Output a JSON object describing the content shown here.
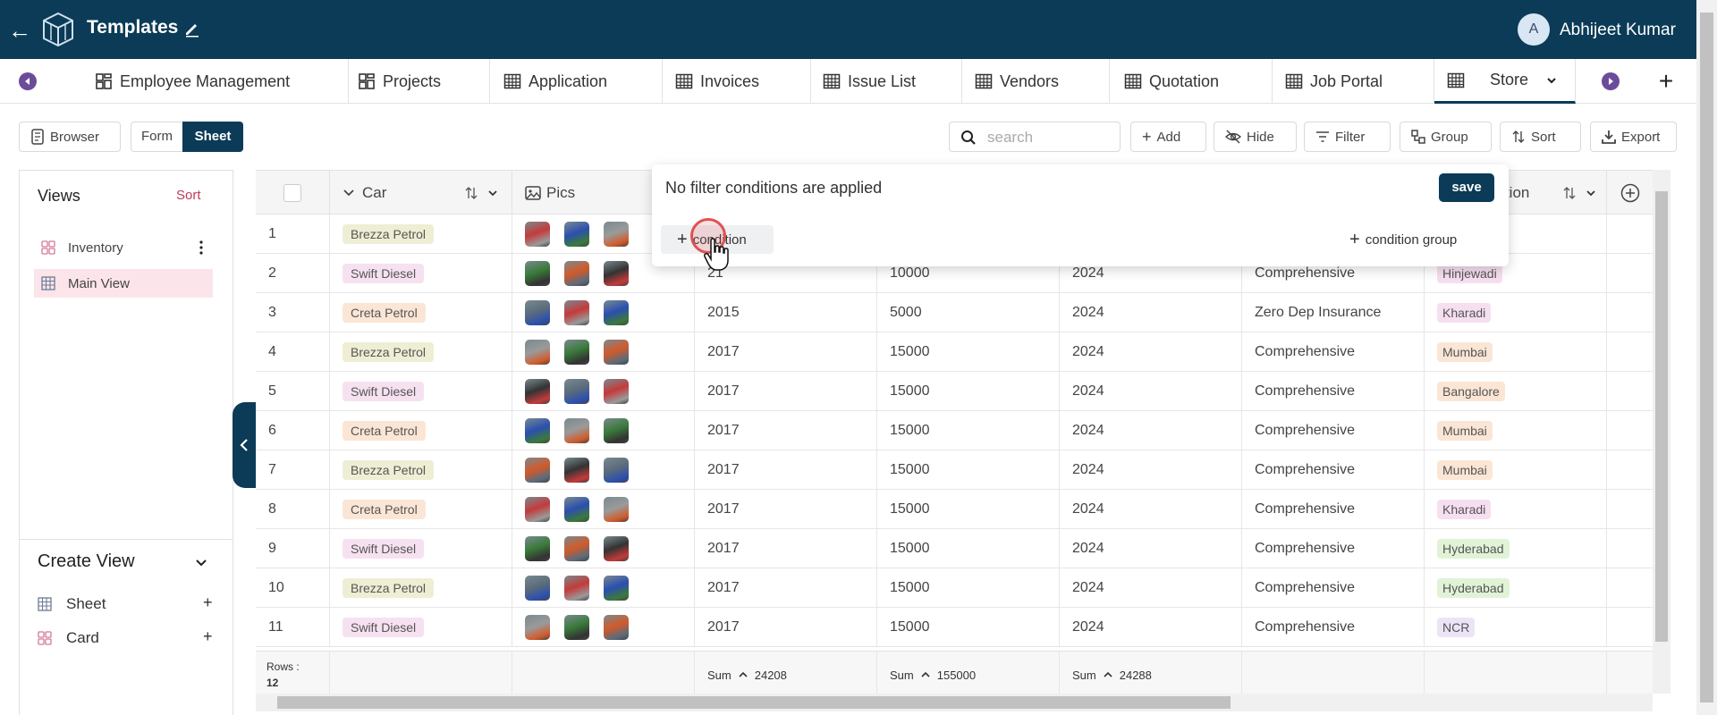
{
  "header": {
    "title": "Templates",
    "user_initial": "A",
    "user_name": "Abhijeet Kumar"
  },
  "tabs": [
    {
      "label": "Employee Management",
      "icon": "dashboard-icon"
    },
    {
      "label": "Projects",
      "icon": "dashboard-icon"
    },
    {
      "label": "Application",
      "icon": "table-icon"
    },
    {
      "label": "Invoices",
      "icon": "table-icon"
    },
    {
      "label": "Issue List",
      "icon": "table-icon"
    },
    {
      "label": "Vendors",
      "icon": "table-icon"
    },
    {
      "label": "Quotation",
      "icon": "table-icon"
    },
    {
      "label": "Job Portal",
      "icon": "table-icon"
    },
    {
      "label": "Store",
      "icon": "table-icon",
      "active": true
    }
  ],
  "toolbar": {
    "browser": "Browser",
    "form": "Form",
    "sheet": "Sheet",
    "search_placeholder": "search",
    "add": "Add",
    "hide": "Hide",
    "filter": "Filter",
    "group": "Group",
    "sort": "Sort",
    "export": "Export"
  },
  "sidebar": {
    "views_title": "Views",
    "sort_label": "Sort",
    "views": [
      {
        "label": "Inventory",
        "icon": "card-grid-icon"
      },
      {
        "label": "Main View",
        "icon": "sheet-grid-icon",
        "active": true
      }
    ],
    "create_view_title": "Create View",
    "create_items": [
      {
        "label": "Sheet",
        "icon": "sheet-grid-icon"
      },
      {
        "label": "Card",
        "icon": "card-grid-icon"
      }
    ]
  },
  "grid": {
    "columns": {
      "car": "Car",
      "pics": "Pics",
      "location_partial": "cation"
    },
    "rows": [
      {
        "n": "1",
        "car": "Brezza Petrol",
        "year": "",
        "km": "",
        "reg": "",
        "insurance": "",
        "location": ""
      },
      {
        "n": "2",
        "car": "Swift Diesel",
        "year": "21",
        "km": "10000",
        "reg": "2024",
        "insurance": "Comprehensive",
        "location": "Hinjewadi"
      },
      {
        "n": "3",
        "car": "Creta Petrol",
        "year": "2015",
        "km": "5000",
        "reg": "2024",
        "insurance": "Zero Dep Insurance",
        "location": "Kharadi"
      },
      {
        "n": "4",
        "car": "Brezza Petrol",
        "year": "2017",
        "km": "15000",
        "reg": "2024",
        "insurance": "Comprehensive",
        "location": "Mumbai"
      },
      {
        "n": "5",
        "car": "Swift Diesel",
        "year": "2017",
        "km": "15000",
        "reg": "2024",
        "insurance": "Comprehensive",
        "location": "Bangalore"
      },
      {
        "n": "6",
        "car": "Creta Petrol",
        "year": "2017",
        "km": "15000",
        "reg": "2024",
        "insurance": "Comprehensive",
        "location": "Mumbai"
      },
      {
        "n": "7",
        "car": "Brezza Petrol",
        "year": "2017",
        "km": "15000",
        "reg": "2024",
        "insurance": "Comprehensive",
        "location": "Mumbai"
      },
      {
        "n": "8",
        "car": "Creta Petrol",
        "year": "2017",
        "km": "15000",
        "reg": "2024",
        "insurance": "Comprehensive",
        "location": "Kharadi"
      },
      {
        "n": "9",
        "car": "Swift Diesel",
        "year": "2017",
        "km": "15000",
        "reg": "2024",
        "insurance": "Comprehensive",
        "location": "Hyderabad"
      },
      {
        "n": "10",
        "car": "Brezza Petrol",
        "year": "2017",
        "km": "15000",
        "reg": "2024",
        "insurance": "Comprehensive",
        "location": "Hyderabad"
      },
      {
        "n": "11",
        "car": "Swift Diesel",
        "year": "2017",
        "km": "15000",
        "reg": "2024",
        "insurance": "Comprehensive",
        "location": "NCR"
      }
    ],
    "footer": {
      "rows_label": "Rows :",
      "rows_count": "12",
      "sum_label": "Sum",
      "sum_year": "24208",
      "sum_km": "155000",
      "sum_reg": "24288"
    }
  },
  "chip_colors": {
    "Brezza Petrol": "#eeeed4",
    "Swift Diesel": "#f6e1f1",
    "Creta Petrol": "#fbe6d6",
    "Hinjewadi": "#f6dff0",
    "Kharadi": "#f6dff0",
    "Mumbai": "#fbe6d6",
    "Bangalore": "#fbe6d6",
    "Hyderabad": "#e1f3d6",
    "NCR": "#ece4f6"
  },
  "filter_popup": {
    "message": "No filter conditions are applied",
    "save": "save",
    "add_condition": "condition",
    "add_condition_group": "condition group"
  },
  "colors": {
    "brand": "#0b3b57",
    "accent": "#c0395a"
  }
}
